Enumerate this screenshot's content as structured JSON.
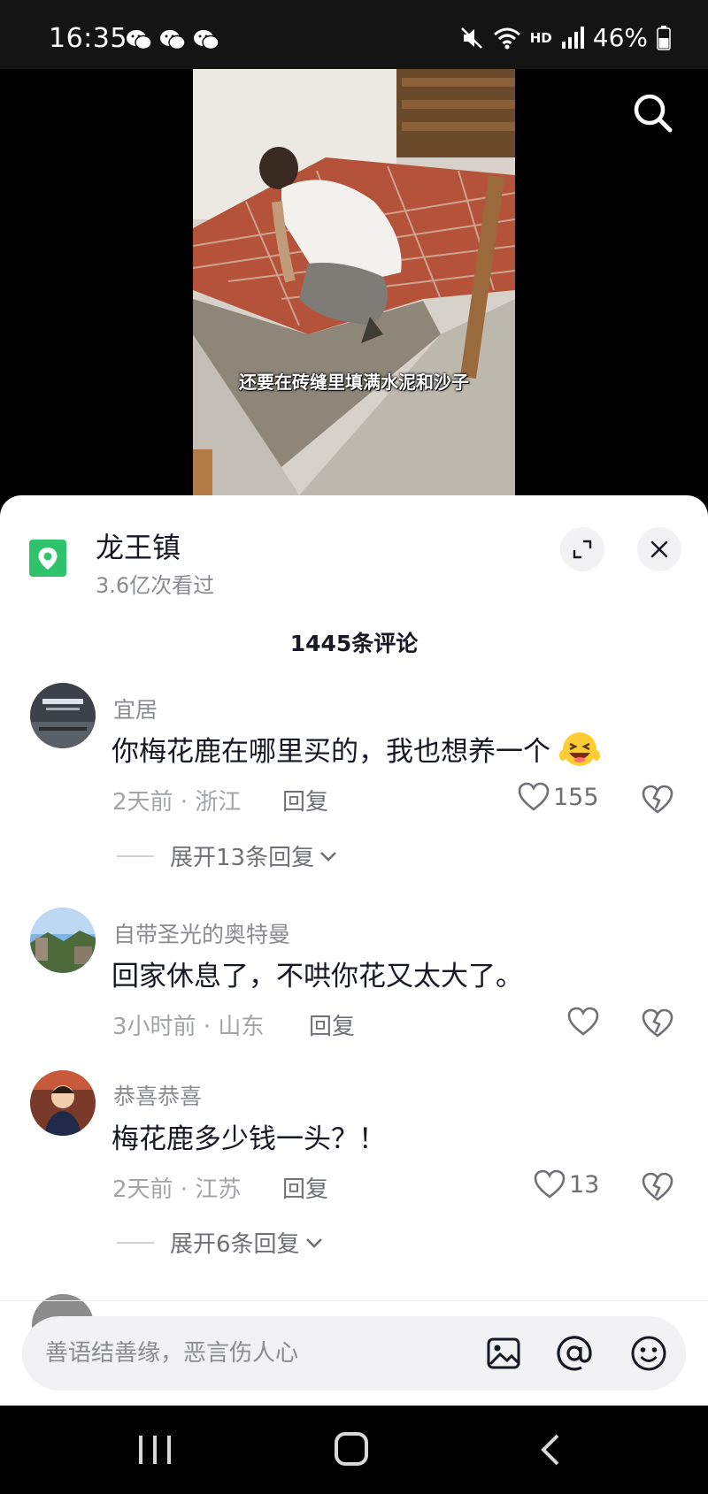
{
  "status_bar": {
    "time": "16:35",
    "battery": "46%",
    "network_label": "HD",
    "icons": [
      "wechat-icon",
      "wechat-icon",
      "wechat-icon",
      "mute-icon",
      "wifi-icon",
      "signal-icon",
      "battery-icon"
    ]
  },
  "video": {
    "caption": "还要在砖缝里填满水泥和沙子",
    "search_icon": "search-icon"
  },
  "location": {
    "name": "龙王镇",
    "views": "3.6亿次看过",
    "icon": "map-pin-icon",
    "accent_color": "#2fc36b"
  },
  "comments_header": {
    "count_label": "1445条评论"
  },
  "comments": [
    {
      "username": "宜居",
      "text": "你梅花鹿在哪里买的，我也想养一个",
      "emoji": "grinning-wink-emoji",
      "meta": "2天前 · 浙江",
      "reply_label": "回复",
      "likes": "155",
      "expand_label": "展开13条回复"
    },
    {
      "username": "自带圣光的奥特曼",
      "text": "回家休息了，不哄你花又太大了。",
      "meta": "3小时前 · 山东",
      "reply_label": "回复",
      "likes": ""
    },
    {
      "username": "恭喜恭喜",
      "text": "梅花鹿多少钱一头？！",
      "meta": "2天前 · 江苏",
      "reply_label": "回复",
      "likes": "13",
      "expand_label": "展开6条回复"
    }
  ],
  "input": {
    "placeholder": "善语结善缘，恶言伤人心",
    "value": ""
  },
  "colors": {
    "text_primary": "#161823",
    "text_secondary": "#8a8b91",
    "sheet_bg": "#ffffff"
  }
}
